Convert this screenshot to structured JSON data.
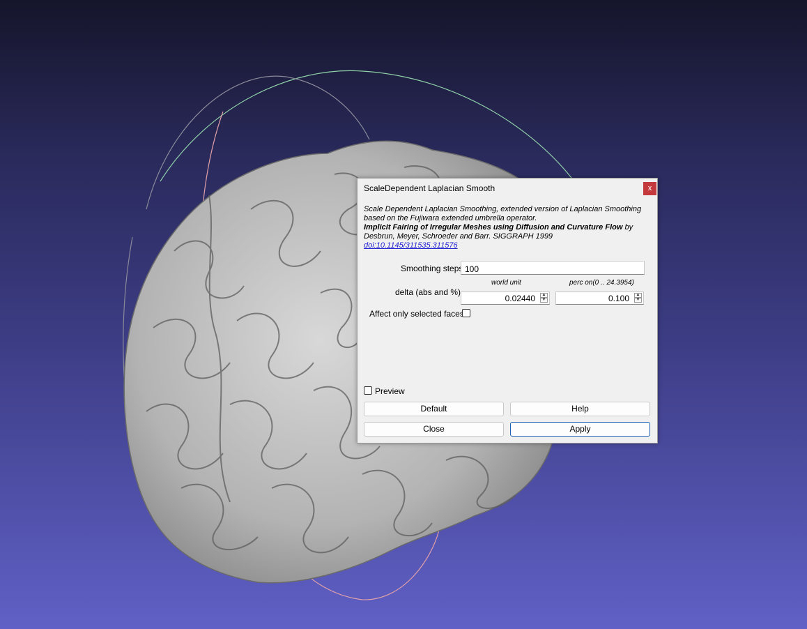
{
  "dialog": {
    "title": "ScaleDependent Laplacian Smooth",
    "close_label": "x",
    "description": {
      "line1": "Scale Dependent Laplacian Smoothing, extended version of Laplacian Smoothing",
      "line2": "based on the Fujiwara extended umbrella operator.",
      "paper_title": "Implicit Fairing of Irregular Meshes using Diffusion and Curvature Flow",
      "by": " by",
      "authors": "Desbrun, Meyer, Schroeder and Barr. SIGGRAPH 1999",
      "doi": "doi:10.1145/311535.311576"
    },
    "smoothing_steps": {
      "label": "Smoothing steps",
      "value": "100"
    },
    "delta": {
      "label": "delta (abs and %)",
      "abs_header": "world unit",
      "perc_header": "perc on(0 .. 24.3954)",
      "abs_value": "0.02440",
      "perc_value": "0.100"
    },
    "affect_selected": {
      "label": "Affect only selected faces",
      "checked": false
    },
    "preview": {
      "label": "Preview",
      "checked": false
    },
    "buttons": {
      "default": "Default",
      "help": "Help",
      "close": "Close",
      "apply": "Apply"
    }
  },
  "colors": {
    "background_top": "#15152b",
    "background_bottom": "#6060c6",
    "mesh": "#bdbdbd",
    "close_button": "#c4393b",
    "link": "#1f1fcf"
  }
}
